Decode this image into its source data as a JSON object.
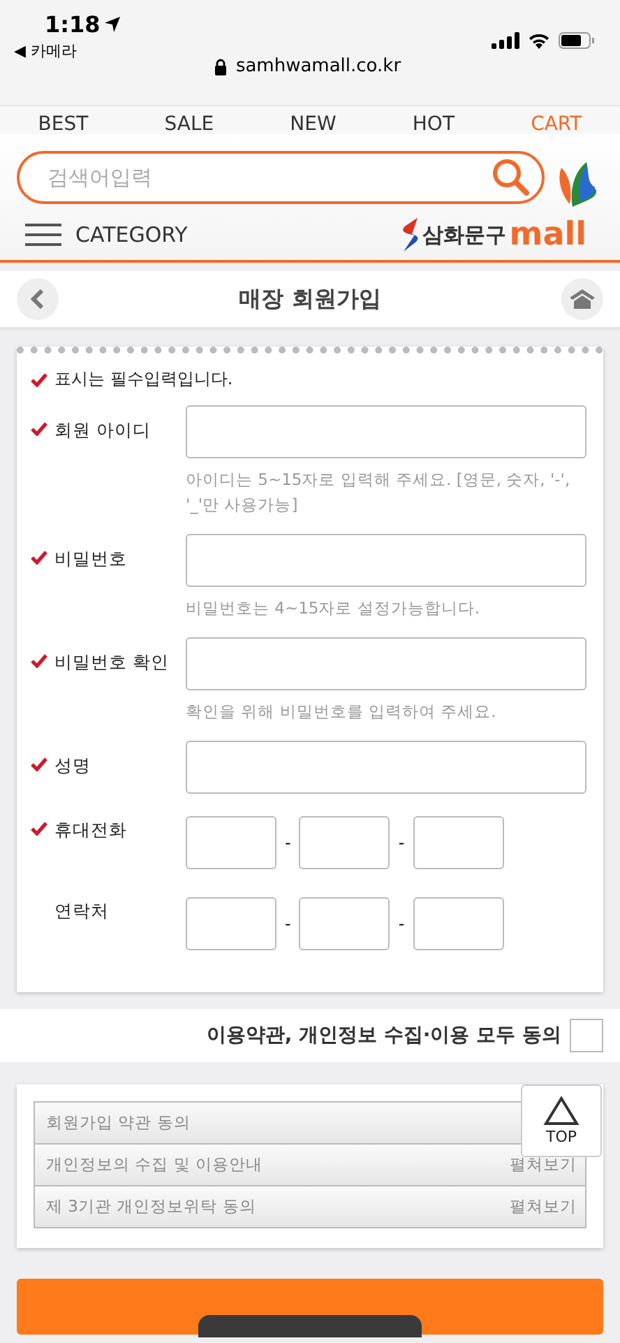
{
  "status_bar": {
    "time": "1:18",
    "back_app": "◀ 카메라"
  },
  "browser": {
    "url": "samhwamall.co.kr"
  },
  "nav_tabs": [
    {
      "label": "BEST",
      "selected": false
    },
    {
      "label": "SALE",
      "selected": false
    },
    {
      "label": "NEW",
      "selected": false
    },
    {
      "label": "HOT",
      "selected": false
    },
    {
      "label": "CART",
      "selected": true
    }
  ],
  "search": {
    "placeholder": "검색어입력"
  },
  "category": {
    "label": "CATEGORY"
  },
  "logo": {
    "text": "삼화문구",
    "brand": "mall"
  },
  "page_title": "매장 회원가입",
  "form": {
    "notice": "표시는 필수입력입니다.",
    "fields": [
      {
        "label": "회원 아이디",
        "required": true,
        "kind": "text",
        "help": "아이디는 5~15자로 입력해 주세요. [영문, 숫자, '-', '_'만 사용가능]"
      },
      {
        "label": "비밀번호",
        "required": true,
        "kind": "text",
        "help": "비밀번호는 4~15자로 설정가능합니다."
      },
      {
        "label": "비밀번호 확인",
        "required": true,
        "kind": "text",
        "help": "확인을 위해 비밀번호를 입력하여 주세요."
      },
      {
        "label": "성명",
        "required": true,
        "kind": "text"
      },
      {
        "label": "휴대전화",
        "required": true,
        "kind": "phone",
        "separators": [
          "-",
          "-"
        ]
      },
      {
        "label": "연락처",
        "required": false,
        "kind": "phone",
        "separators": [
          "-",
          "-"
        ]
      }
    ]
  },
  "agree_all": {
    "label": "이용약관, 개인정보 수집·이용 모두 동의",
    "checked": false
  },
  "terms": [
    {
      "title": "회원가입 약관 동의"
    },
    {
      "title": "개인정보의 수집 및 이용안내",
      "toggle": "펼쳐보기"
    },
    {
      "title": "제 3기관 개인정보위탁 동의",
      "toggle": "펼쳐보기"
    }
  ],
  "top_button": {
    "label": "TOP"
  }
}
